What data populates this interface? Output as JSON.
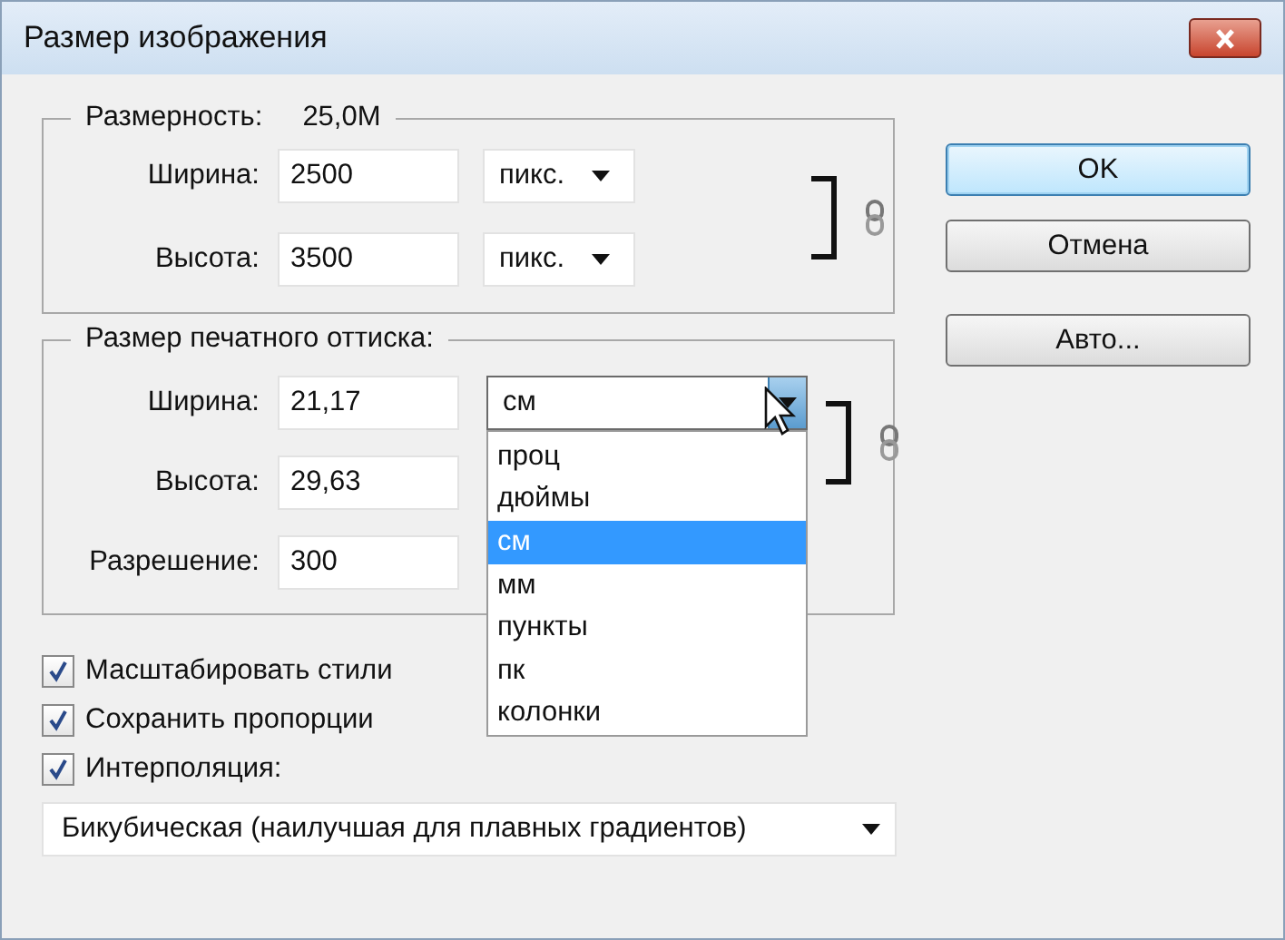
{
  "window": {
    "title": "Размер изображения"
  },
  "pixel_dimensions": {
    "label": "Размерность:",
    "value": "25,0M",
    "fields": [
      {
        "label": "Ширина:",
        "value": "2500",
        "unit": {
          "value": "пикс.",
          "expanded": false
        }
      },
      {
        "label": "Высота:",
        "value": "3500",
        "unit": {
          "value": "пикс.",
          "expanded": false
        }
      }
    ]
  },
  "document_size": {
    "label": "Размер печатного оттиска:",
    "fields": [
      {
        "label": "Ширина:",
        "value": "21,17",
        "unit": {
          "value": "см",
          "expanded": true
        }
      },
      {
        "label": "Высота:",
        "value": "29,63"
      },
      {
        "label": "Разрешение:",
        "value": "300"
      }
    ],
    "unit_menu": [
      {
        "label": "проц",
        "selected": false
      },
      {
        "label": "дюймы",
        "selected": false
      },
      {
        "label": "см",
        "selected": true
      },
      {
        "label": "мм",
        "selected": false
      },
      {
        "label": "пункты",
        "selected": false
      },
      {
        "label": "пк",
        "selected": false
      },
      {
        "label": "колонки",
        "selected": false
      }
    ]
  },
  "options": [
    {
      "label": "Масштабировать стили",
      "checked": true
    },
    {
      "label": "Сохранить пропорции",
      "checked": true
    },
    {
      "label": "Интерполяция:",
      "checked": true
    }
  ],
  "interpolation": {
    "value": "Бикубическая (наилучшая для плавных градиентов)"
  },
  "buttons": [
    {
      "label": "OK",
      "default": true
    },
    {
      "label": "Отмена",
      "default": false
    },
    {
      "label": "Авто...",
      "default": false
    }
  ]
}
